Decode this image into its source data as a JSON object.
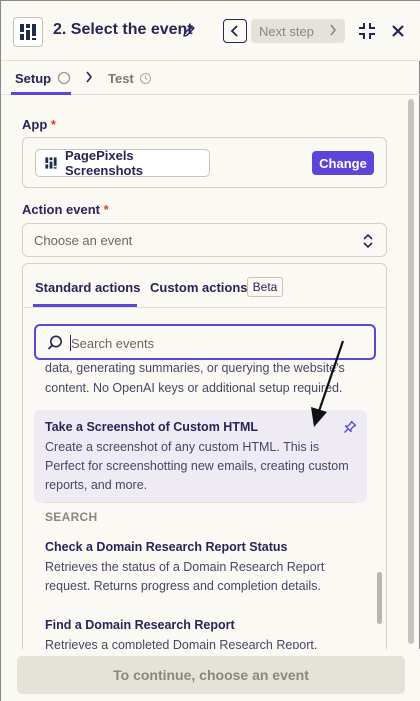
{
  "header": {
    "step_title": "2. Select the event",
    "next_step_label": "Next step"
  },
  "tabs": {
    "setup_label": "Setup",
    "test_label": "Test"
  },
  "form": {
    "app_label": "App",
    "app_required_mark": "*",
    "app_name": "PagePixels Screenshots",
    "change_label": "Change",
    "action_event_label": "Action event",
    "action_event_required_mark": "*",
    "action_event_placeholder": "Choose an event"
  },
  "dropdown": {
    "tabs": {
      "standard": "Standard actions",
      "custom": "Custom actions",
      "beta_badge": "Beta"
    },
    "search_placeholder": "Search events",
    "intro_text": "data, generating summaries, or querying the website's content. No OpenAI keys or additional setup required.",
    "items": [
      {
        "title": "Take a Screenshot of Custom HTML",
        "description": "Create a screenshot of any custom HTML. This is Perfect for screenshotting new emails, creating custom reports, and more."
      }
    ],
    "search_section": {
      "label": "SEARCH",
      "items": [
        {
          "title": "Check a Domain Research Report Status",
          "description": "Retrieves the status of a Domain Research Report request. Returns progress and completion details."
        },
        {
          "title": "Find a Domain Research Report",
          "description": "Retrieves a completed Domain Research Report."
        }
      ]
    }
  },
  "footer": {
    "continue_label": "To continue, choose an event"
  },
  "colors": {
    "accent": "#5b46d9",
    "text_primary": "#2b2358",
    "required": "#d9412b",
    "background": "#fbf9f3",
    "highlight_row": "#eeebf4"
  }
}
